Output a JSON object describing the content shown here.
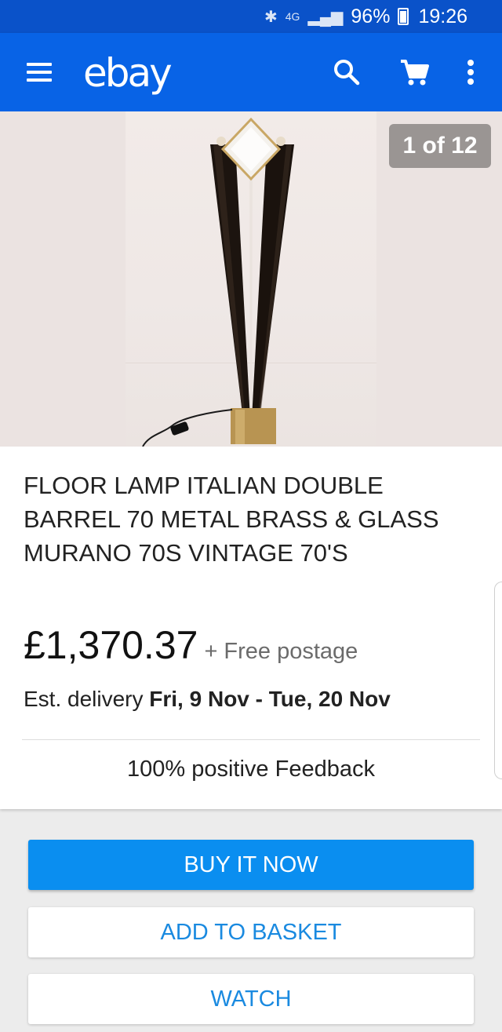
{
  "status_bar": {
    "network": "4G",
    "battery": "96%",
    "time": "19:26",
    "icons": [
      "bluetooth-icon",
      "wifi-icon",
      "signal-icon",
      "battery-icon"
    ]
  },
  "app_bar": {
    "logo": "ebay",
    "icons": [
      "menu-icon",
      "search-icon",
      "cart-icon",
      "more-icon"
    ]
  },
  "gallery": {
    "counter": "1 of 12"
  },
  "listing": {
    "title": "FLOOR LAMP ITALIAN DOUBLE BARREL 70 METAL BRASS & GLASS MURANO 70S VINTAGE 70'S",
    "price": "£1,370.37",
    "postage": "+ Free postage",
    "delivery_label": "Est. delivery ",
    "delivery_dates": "Fri, 9 Nov - Tue, 20 Nov",
    "feedback": "100% positive Feedback"
  },
  "actions": {
    "buy_now": "BUY IT NOW",
    "add_to_basket": "ADD TO BASKET",
    "watch": "WATCH"
  },
  "colors": {
    "status_bar": "#0a52c9",
    "app_bar": "#0863e6",
    "buy_button": "#0a8ef0",
    "link_blue": "#1a8ae0"
  }
}
